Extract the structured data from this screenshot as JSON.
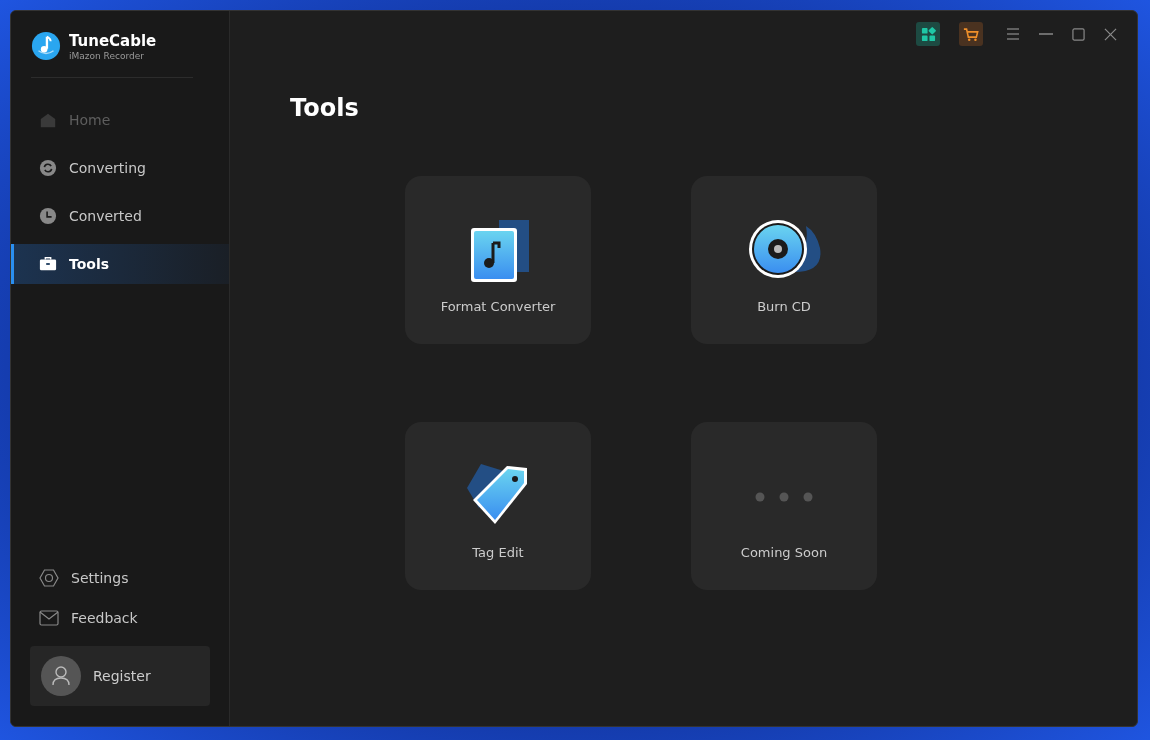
{
  "app": {
    "name": "TuneCable",
    "subtitle": "iMazon Recorder"
  },
  "nav": [
    {
      "label": "Home",
      "selected": false,
      "disabled": true
    },
    {
      "label": "Converting",
      "selected": false,
      "disabled": false
    },
    {
      "label": "Converted",
      "selected": false,
      "disabled": false
    },
    {
      "label": "Tools",
      "selected": true,
      "disabled": false
    }
  ],
  "bottom_nav": [
    {
      "label": "Settings"
    },
    {
      "label": "Feedback"
    }
  ],
  "register": {
    "label": "Register"
  },
  "page": {
    "title": "Tools"
  },
  "tools": [
    {
      "label": "Format Converter"
    },
    {
      "label": "Burn CD"
    },
    {
      "label": "Tag Edit"
    },
    {
      "label": "Coming Soon"
    }
  ]
}
